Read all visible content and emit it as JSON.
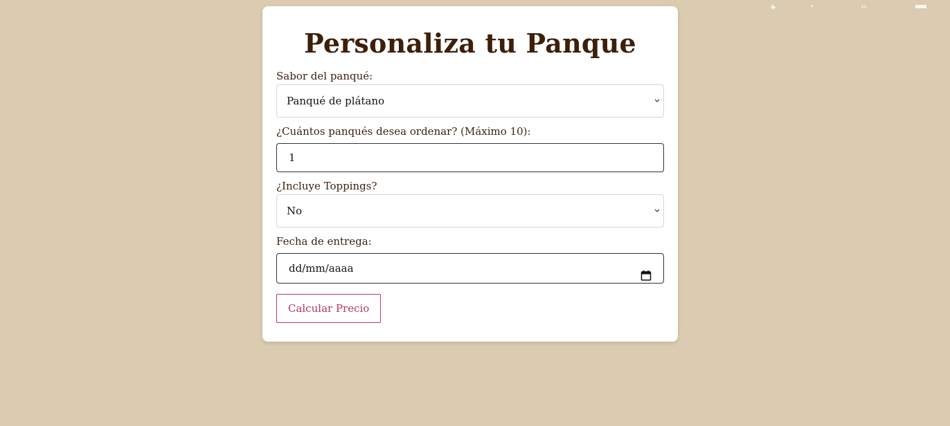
{
  "form": {
    "title": "Personaliza tu Panque",
    "flavor_label": "Sabor del panqué:",
    "flavor_value": "Panqué de plátano",
    "quantity_label": "¿Cuántos panqués desea ordenar? (Máximo 10):",
    "quantity_value": "1",
    "toppings_label": "¿Incluye Toppings?",
    "toppings_value": "No",
    "date_label": "Fecha de entrega:",
    "date_placeholder": "dd/mm/aaaa",
    "submit_label": "Calcular Precio"
  },
  "colors": {
    "background": "#dacbb1",
    "card": "#ffffff",
    "title": "#3d1f0a",
    "button_accent": "#b8336a"
  }
}
